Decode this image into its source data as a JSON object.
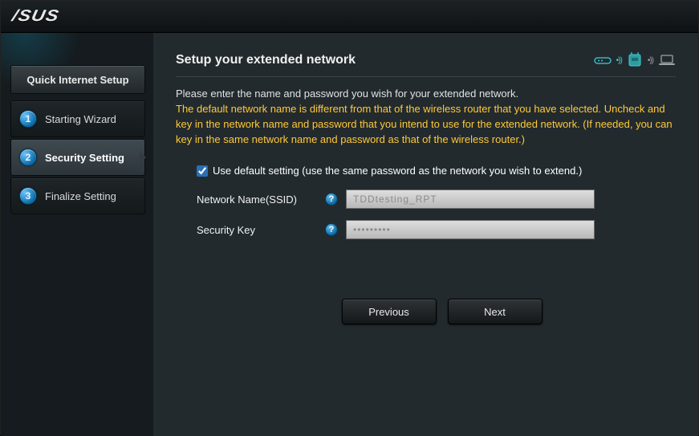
{
  "logo": "/SUS",
  "sidebar": {
    "title": "Quick Internet Setup",
    "steps": [
      {
        "num": "1",
        "label": "Starting Wizard"
      },
      {
        "num": "2",
        "label": "Security Setting"
      },
      {
        "num": "3",
        "label": "Finalize Setting"
      }
    ],
    "active_index": 1
  },
  "main": {
    "title": "Setup your extended network",
    "instr_line1": "Please enter the name and password you wish for your extended network.",
    "instr_warn": "The default network name is different from that of the wireless router that you have selected. Uncheck and key in the network name and password that you intend to use for the extended network. (If needed, you can key in the same network name and password as that of the wireless router.)",
    "checkbox_label": "Use default setting (use the same password as the network you wish to extend.)",
    "checkbox_checked": true,
    "fields": {
      "ssid_label": "Network Name(SSID)",
      "ssid_value": "TDDtesting_RPT",
      "key_label": "Security Key",
      "key_value": "•••••••••"
    },
    "buttons": {
      "prev": "Previous",
      "next": "Next"
    }
  }
}
